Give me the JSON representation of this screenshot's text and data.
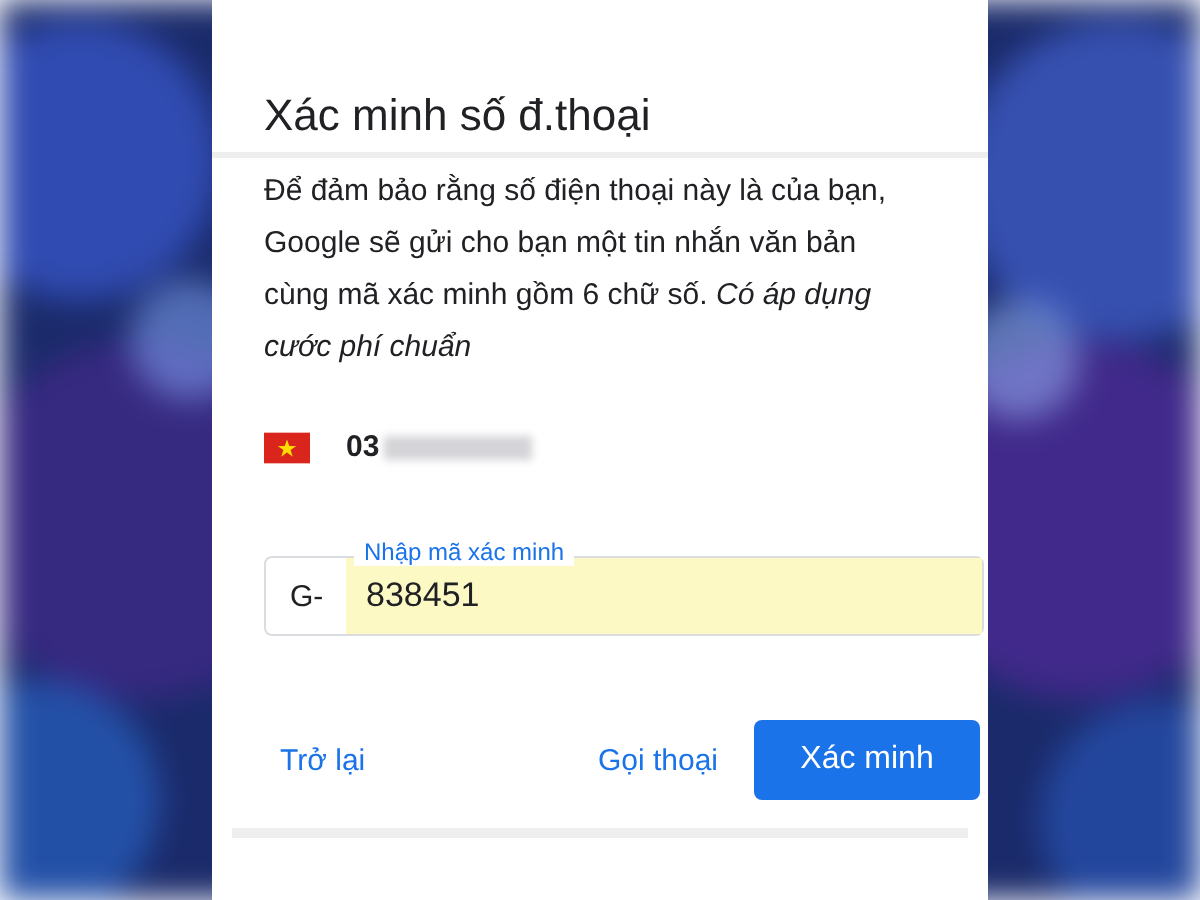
{
  "dialog": {
    "title": "Xác minh số đ.thoại",
    "message": "Để đảm bảo rằng số điện thoại này là của bạn, Google sẽ gửi cho bạn một tin nhắn văn bản cùng mã xác minh gồm 6 chữ số. *Có áp dụng cước phí chuẩn*",
    "phone": {
      "prefix": "03"
    },
    "code_field": {
      "label": "Nhập mã xác minh",
      "prefix": "G-",
      "value": "838451"
    },
    "buttons": [
      {
        "label": "Trở lại",
        "kind": "text"
      },
      {
        "label": "Gọi thoại",
        "kind": "text"
      },
      {
        "label": "Xác minh",
        "kind": "primary"
      }
    ]
  }
}
